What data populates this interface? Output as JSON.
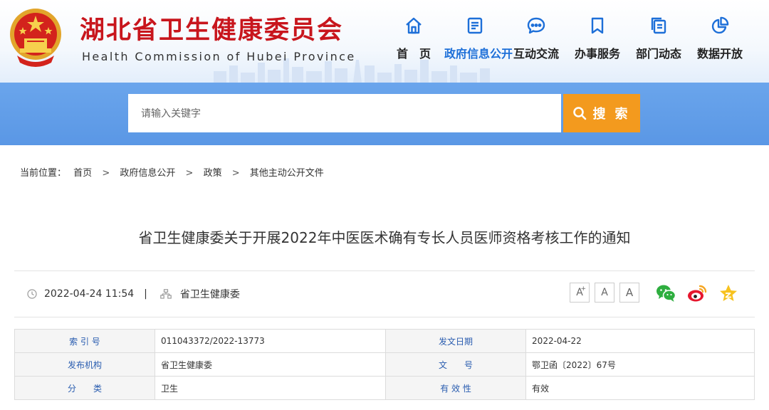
{
  "header": {
    "title": "湖北省卫生健康委员会",
    "subtitle": "Health Commission of Hubei Province"
  },
  "nav": [
    {
      "label": "首　页",
      "icon": "home-icon"
    },
    {
      "label": "政府信息公开",
      "icon": "document-icon",
      "active": true
    },
    {
      "label": "互动交流",
      "icon": "chat-icon"
    },
    {
      "label": "办事服务",
      "icon": "bookmark-icon"
    },
    {
      "label": "部门动态",
      "icon": "copy-icon"
    },
    {
      "label": "数据开放",
      "icon": "pie-chart-icon"
    }
  ],
  "search": {
    "placeholder": "请输入关键字",
    "button_label": "搜 索"
  },
  "breadcrumb": {
    "prefix": "当前位置：",
    "items": [
      "首页",
      "政府信息公开",
      "政策",
      "其他主动公开文件"
    ],
    "separator": ">"
  },
  "article": {
    "title": "省卫生健康委关于开展2022年中医医术确有专长人员医师资格考核工作的通知",
    "datetime": "2022-04-24 11:54",
    "divider": "|",
    "publisher": "省卫生健康委"
  },
  "font_controls": [
    "A+",
    "A",
    "A-"
  ],
  "share": [
    "wechat-icon",
    "weibo-icon",
    "favorite-icon"
  ],
  "info": [
    {
      "label1": "索 引 号",
      "value1": "011043372/2022-13773",
      "label2": "发文日期",
      "value2": "2022-04-22"
    },
    {
      "label1": "发布机构",
      "value1": "省卫生健康委",
      "label2": "文　　号",
      "value2": "鄂卫函〔2022〕67号"
    },
    {
      "label1": "分　　类",
      "value1": "卫生",
      "label2": "有 效 性",
      "value2": "有效"
    }
  ],
  "colors": {
    "brand_red": "#c8161d",
    "nav_active": "#1d6fd8",
    "search_band": "#5a97e5",
    "search_button": "#f39a1e",
    "label_blue": "#2a5db0"
  }
}
